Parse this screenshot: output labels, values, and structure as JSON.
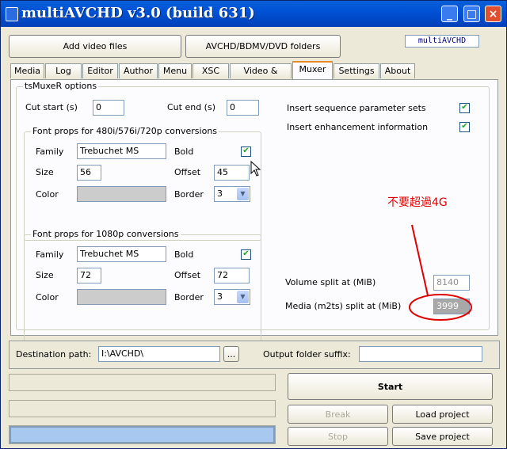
{
  "window": {
    "title": "multiAVCHD v3.0 (build 631)",
    "logo": "multiAVCHD"
  },
  "titlebar": {
    "minimize": "_",
    "maximize": "□",
    "close": "×"
  },
  "top_buttons": {
    "add_video": "Add video files",
    "folders": "AVCHD/BDMV/DVD folders"
  },
  "tabs": [
    "Media",
    "Log",
    "Editor",
    "Author",
    "Menu",
    "XSC",
    "Video & Audio",
    "Muxer",
    "Settings",
    "About"
  ],
  "active_tab": "Muxer",
  "muxer": {
    "group_title": "tsMuxeR options",
    "cut_start_label": "Cut start (s)",
    "cut_start_value": "0",
    "cut_end_label": "Cut end (s)",
    "cut_end_value": "0",
    "insert_sps_label": "Insert sequence parameter sets",
    "insert_sps": true,
    "insert_sei_label": "Insert enhancement information",
    "insert_sei": true,
    "font480": {
      "title": "Font props for 480i/576i/720p conversions",
      "family_label": "Family",
      "family": "Trebuchet MS",
      "bold_label": "Bold",
      "bold": true,
      "size_label": "Size",
      "size": "56",
      "offset_label": "Offset",
      "offset": "45",
      "color_label": "Color",
      "border_label": "Border",
      "border": "3"
    },
    "font1080": {
      "title": "Font props for 1080p conversions",
      "family_label": "Family",
      "family": "Trebuchet MS",
      "bold_label": "Bold",
      "bold": true,
      "size_label": "Size",
      "size": "72",
      "offset_label": "Offset",
      "offset": "72",
      "color_label": "Color",
      "border_label": "Border",
      "border": "3"
    },
    "volume_split_label": "Volume split at (MiB)",
    "volume_split": "8140",
    "media_split_label": "Media (m2ts) split at (MiB)",
    "media_split": "3999",
    "annotation": "不要超過4G"
  },
  "bottom": {
    "destination_label": "Destination path:",
    "destination": "I:\\AVCHD\\",
    "browse": "...",
    "suffix_label": "Output folder suffix:",
    "suffix": "",
    "start": "Start",
    "break": "Break",
    "load_project": "Load project",
    "stop": "Stop",
    "save_project": "Save project",
    "progress": 1.0
  },
  "colors": {
    "title_bar": "#0052d6",
    "annotation": "#e00000",
    "active_tab_accent": "#e68b2c",
    "progress": "#a9c8ef"
  }
}
